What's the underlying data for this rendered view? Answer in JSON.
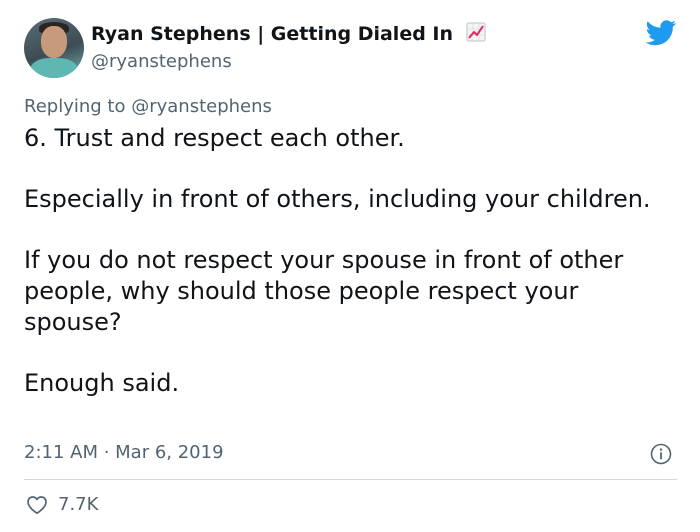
{
  "author": {
    "display_name": "Ryan Stephens | Getting Dialed In",
    "handle": "@ryanstephens",
    "name_emoji": "chart-increasing-icon"
  },
  "reply": {
    "prefix": "Replying to ",
    "mention": "@ryanstephens"
  },
  "tweet": {
    "paragraphs": [
      "6. Trust and respect each other.",
      "Especially in front of others, including your children.",
      "If you do not respect your spouse in front of other people, why should those people respect your spouse?",
      "Enough said."
    ],
    "timestamp": "2:11 AM · Mar 6, 2019"
  },
  "engagement": {
    "likes": "7.7K"
  },
  "colors": {
    "brand": "#1d9bf0",
    "text": "#0f1419",
    "secondary": "#536471",
    "divider": "#cfd9de"
  },
  "icons": {
    "logo": "twitter-bird-icon",
    "info": "info-icon",
    "like": "heart-icon"
  }
}
